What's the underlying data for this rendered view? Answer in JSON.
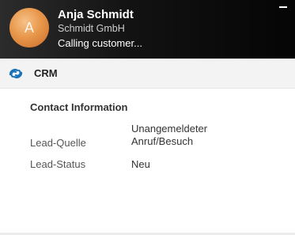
{
  "caller": {
    "name": "Anja Schmidt",
    "company": "Schmidt GmbH",
    "status": "Calling customer...",
    "avatar_initial": "A"
  },
  "crm": {
    "label": "CRM",
    "icon": "crm-sync-icon",
    "accent_color": "#1a73b8"
  },
  "contact_info": {
    "title": "Contact Information",
    "fields": [
      {
        "label": "Lead-Quelle",
        "value_line1": "Unangemeldeter",
        "value_line2": "Anruf/Besuch"
      },
      {
        "label": "Lead-Status",
        "value": "Neu"
      }
    ]
  },
  "header_colors": {
    "background": "#121212",
    "text": "#ffffff"
  }
}
